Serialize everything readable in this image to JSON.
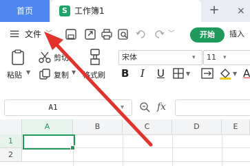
{
  "tabs": {
    "home_label": "首页",
    "doc_title": "工作簿1",
    "doc_icon_letter": "S",
    "close_glyph": "×",
    "new_tab_glyph": "+"
  },
  "toolbar": {
    "file_label": "文件",
    "start_label": "开始",
    "insert_label": "插入"
  },
  "ribbon": {
    "cut_label": "剪切",
    "copy_label": "复制",
    "paste_label": "粘贴",
    "format_painter_label": "格式刷",
    "font_name": "宋体",
    "font_size": "11",
    "bold": "B",
    "italic": "I",
    "underline": "U",
    "font_color_letter": "A"
  },
  "formula_bar": {
    "name_box": "A1",
    "fx_label": "fx"
  },
  "sheet": {
    "columns": [
      "A",
      "B",
      "C",
      "D",
      "E"
    ],
    "rows": [
      "1",
      "2"
    ]
  },
  "colors": {
    "accent_blue": "#4f86ef",
    "start_green": "#1e9a5c",
    "active_cell": "#1f9a5c",
    "annotation_arrow": "#e4322b"
  }
}
